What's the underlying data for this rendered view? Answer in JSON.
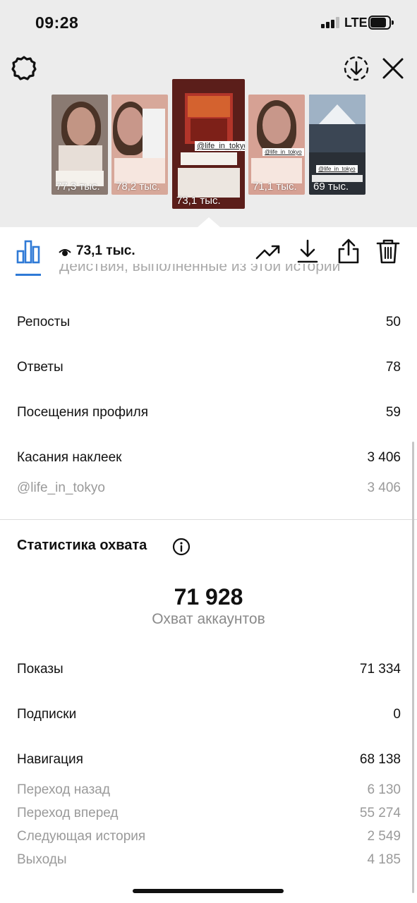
{
  "status_bar": {
    "time": "09:28",
    "network": "LTE"
  },
  "header": {
    "settings_icon": "gear-icon",
    "download_story_icon": "circle-download-icon",
    "close_icon": "close-icon"
  },
  "stories": [
    {
      "count": "77,3 тыс.",
      "sticker": ""
    },
    {
      "count": "78,2 тыс.",
      "sticker": ""
    },
    {
      "count": "73,1 тыс.",
      "sticker": "@life_in_tokyo",
      "active": true
    },
    {
      "count": "71,1 тыс.",
      "sticker": "@life_in_tokyo"
    },
    {
      "count": "69 тыс.",
      "sticker": "@life_in_tokyo"
    }
  ],
  "toolbar": {
    "insights_icon": "bar-chart-icon",
    "views_icon": "eye-icon",
    "views": "73,1 тыс.",
    "trend_icon": "trend-up-icon",
    "download_icon": "download-icon",
    "share_icon": "share-icon",
    "delete_icon": "trash-icon"
  },
  "interactions": {
    "heading": "Действия, выполненные из этой истории",
    "rows": [
      {
        "label": "Репосты",
        "value": "50"
      },
      {
        "label": "Ответы",
        "value": "78"
      },
      {
        "label": "Посещения профиля",
        "value": "59"
      },
      {
        "label": "Касания наклеек",
        "value": "3 406"
      }
    ],
    "sub_rows": [
      {
        "label": "@life_in_tokyo",
        "value": "3 406"
      }
    ]
  },
  "reach": {
    "title": "Статистика охвата",
    "info_icon": "info-icon",
    "accounts_reached": "71 928",
    "accounts_reached_label": "Охват аккаунтов",
    "rows": [
      {
        "label": "Показы",
        "value": "71 334"
      },
      {
        "label": "Подписки",
        "value": "0"
      },
      {
        "label": "Навигация",
        "value": "68 138"
      }
    ],
    "navigation_breakdown": [
      {
        "label": "Переход назад",
        "value": "6 130"
      },
      {
        "label": "Переход вперед",
        "value": "55 274"
      },
      {
        "label": "Следующая история",
        "value": "2 549"
      },
      {
        "label": "Выходы",
        "value": "4 185"
      }
    ]
  }
}
